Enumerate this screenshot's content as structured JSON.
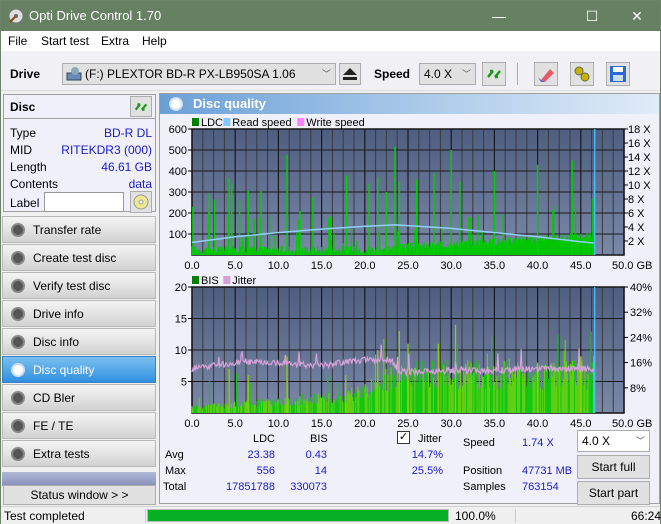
{
  "window": {
    "title": "Opti Drive Control 1.70",
    "minimize": "—",
    "maximize": "☐",
    "close": "✕"
  },
  "menu": [
    "File",
    "Start test",
    "Extra",
    "Help"
  ],
  "toolbar": {
    "drive_label": "Drive",
    "drive_value": "(F:)  PLEXTOR BD-R  PX-LB950SA 1.06",
    "speed_label": "Speed",
    "speed_value": "4.0 X",
    "icons": [
      "eject-icon",
      "refresh-icon",
      "erase-icon",
      "settings-icon",
      "save-icon"
    ]
  },
  "disc": {
    "header": "Disc",
    "rows": [
      {
        "label": "Type",
        "value": "BD-R DL"
      },
      {
        "label": "MID",
        "value": "RITEKDR3 (000)"
      },
      {
        "label": "Length",
        "value": "46.61 GB"
      },
      {
        "label": "Contents",
        "value": "data"
      }
    ],
    "label_field": "Label",
    "label_value": ""
  },
  "nav": [
    {
      "label": "Transfer rate",
      "active": false
    },
    {
      "label": "Create test disc",
      "active": false
    },
    {
      "label": "Verify test disc",
      "active": false
    },
    {
      "label": "Drive info",
      "active": false
    },
    {
      "label": "Disc info",
      "active": false
    },
    {
      "label": "Disc quality",
      "active": true
    },
    {
      "label": "CD Bler",
      "active": false
    },
    {
      "label": "FE / TE",
      "active": false
    },
    {
      "label": "Extra tests",
      "active": false
    }
  ],
  "status_window_button": "Status window > >",
  "main": {
    "title": "Disc quality"
  },
  "chart_data": [
    {
      "type": "bar",
      "title": "LDC / Read speed",
      "legend": [
        "LDC",
        "Read speed",
        "Write speed"
      ],
      "legend_colors": [
        "#008000",
        "#80c8ff",
        "#ff80ff"
      ],
      "legend_placement": "top-left",
      "x_ticks": [
        "0.0",
        "5.0",
        "10.0",
        "15.0",
        "20.0",
        "25.0",
        "30.0",
        "35.0",
        "40.0",
        "45.0",
        "50.0 GB"
      ],
      "xlim": [
        0,
        50
      ],
      "y_ticks": [
        "100",
        "200",
        "300",
        "400",
        "500",
        "600"
      ],
      "ylim": [
        0,
        600
      ],
      "y2_ticks": [
        "2 X",
        "4 X",
        "6 X",
        "8 X",
        "10 X",
        "12 X",
        "14 X",
        "16 X",
        "18 X"
      ],
      "y2lim": [
        0,
        18
      ],
      "disc_end_gb": 46.61,
      "read_speed": {
        "x": [
          0,
          5,
          10,
          15,
          20,
          23.5,
          25,
          30,
          35,
          40,
          45,
          46.6
        ],
        "y": [
          1.8,
          2.6,
          3.2,
          3.7,
          4.1,
          4.3,
          4.2,
          3.8,
          3.2,
          2.6,
          1.9,
          1.7
        ]
      },
      "ldc_peaks": {
        "x": [
          0.1,
          2,
          2.6,
          4.3,
          4.6,
          5.5,
          6.5,
          8,
          11,
          12.5,
          14,
          16,
          17.9,
          20.5,
          21.5,
          22.5,
          23.5,
          24,
          26,
          28,
          30,
          31,
          35,
          40,
          44,
          46.5
        ],
        "y": [
          230,
          295,
          265,
          365,
          340,
          260,
          305,
          305,
          475,
          210,
          275,
          185,
          380,
          340,
          370,
          300,
          515,
          350,
          360,
          390,
          500,
          350,
          400,
          430,
          450,
          350
        ]
      },
      "ldc_baseline": 30
    },
    {
      "type": "bar",
      "title": "BIS / Jitter",
      "legend": [
        "BIS",
        "Jitter"
      ],
      "legend_colors": [
        "#008000",
        "#d8a0d8"
      ],
      "legend_placement": "top-left",
      "x_ticks": [
        "0.0",
        "5.0",
        "10.0",
        "15.0",
        "20.0",
        "25.0",
        "30.0",
        "35.0",
        "40.0",
        "45.0",
        "50.0 GB"
      ],
      "xlim": [
        0,
        50
      ],
      "y_ticks": [
        "5",
        "10",
        "15",
        "20"
      ],
      "ylim": [
        0,
        20
      ],
      "y2_ticks": [
        "8%",
        "16%",
        "24%",
        "32%",
        "40%"
      ],
      "y2lim": [
        0,
        40
      ],
      "disc_end_gb": 46.61,
      "jitter_pct": {
        "x": [
          0,
          5,
          10,
          15,
          20,
          23,
          24,
          25,
          30,
          35,
          40,
          45,
          46.6
        ],
        "y": [
          14,
          16,
          16,
          15,
          17,
          17,
          13,
          13,
          13.5,
          13.5,
          14,
          14,
          14
        ]
      },
      "bis_peaks": {
        "x": [
          4.3,
          6.5,
          11,
          17.8,
          21.5,
          24,
          25,
          28.5,
          30.5,
          40,
          45,
          46.5
        ],
        "y": [
          7,
          6,
          9,
          6,
          10,
          13,
          11,
          11,
          14,
          8,
          9,
          9
        ]
      },
      "bis_baseline": {
        "x": [
          0,
          18,
          23.5,
          47
        ],
        "y": [
          1,
          3,
          7,
          7
        ]
      }
    }
  ],
  "stats": {
    "col_ldc": "LDC",
    "col_bis": "BIS",
    "jitter_checked": true,
    "jitter_label": "Jitter",
    "rows": [
      {
        "label": "Avg",
        "ldc": "23.38",
        "bis": "0.43",
        "jitter": "14.7%"
      },
      {
        "label": "Max",
        "ldc": "556",
        "bis": "14",
        "jitter": "25.5%"
      },
      {
        "label": "Total",
        "ldc": "17851788",
        "bis": "330073",
        "jitter": ""
      }
    ],
    "speed_label": "Speed",
    "speed_value": "1.74 X",
    "position_label": "Position",
    "position_value": "47731 MB",
    "samples_label": "Samples",
    "samples_value": "763154",
    "speed_select": "4.0 X",
    "start_full": "Start full",
    "start_part": "Start part"
  },
  "statusbar": {
    "text": "Test completed",
    "progress": 100.0,
    "progress_text": "100.0%",
    "time": "66:24"
  }
}
